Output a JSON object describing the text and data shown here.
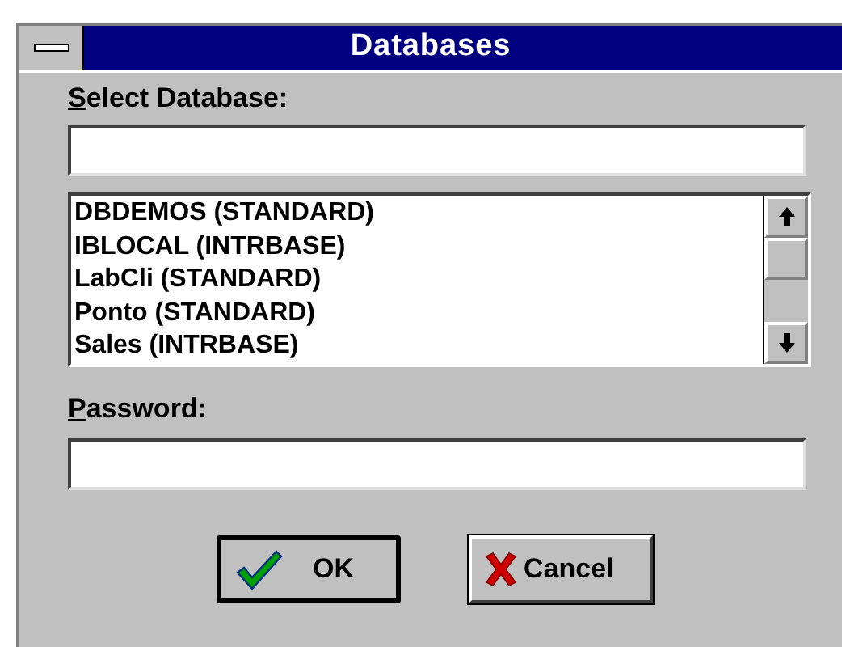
{
  "window": {
    "title": "Databases"
  },
  "select_label": "Select Database:",
  "databases": [
    {
      "label": "DBDEMOS (STANDARD)",
      "selected": false
    },
    {
      "label": "IBLOCAL (INTRBASE)",
      "selected": false
    },
    {
      "label": "LabCli (STANDARD)",
      "selected": false
    },
    {
      "label": "Ponto (STANDARD)",
      "selected": false
    },
    {
      "label": "Sales (INTRBASE)",
      "selected": false
    }
  ],
  "password_label": "Password:",
  "buttons": [
    {
      "label": "OK",
      "kind": "ok",
      "default": true
    },
    {
      "label": "Cancel",
      "kind": "cancel",
      "default": false
    }
  ]
}
